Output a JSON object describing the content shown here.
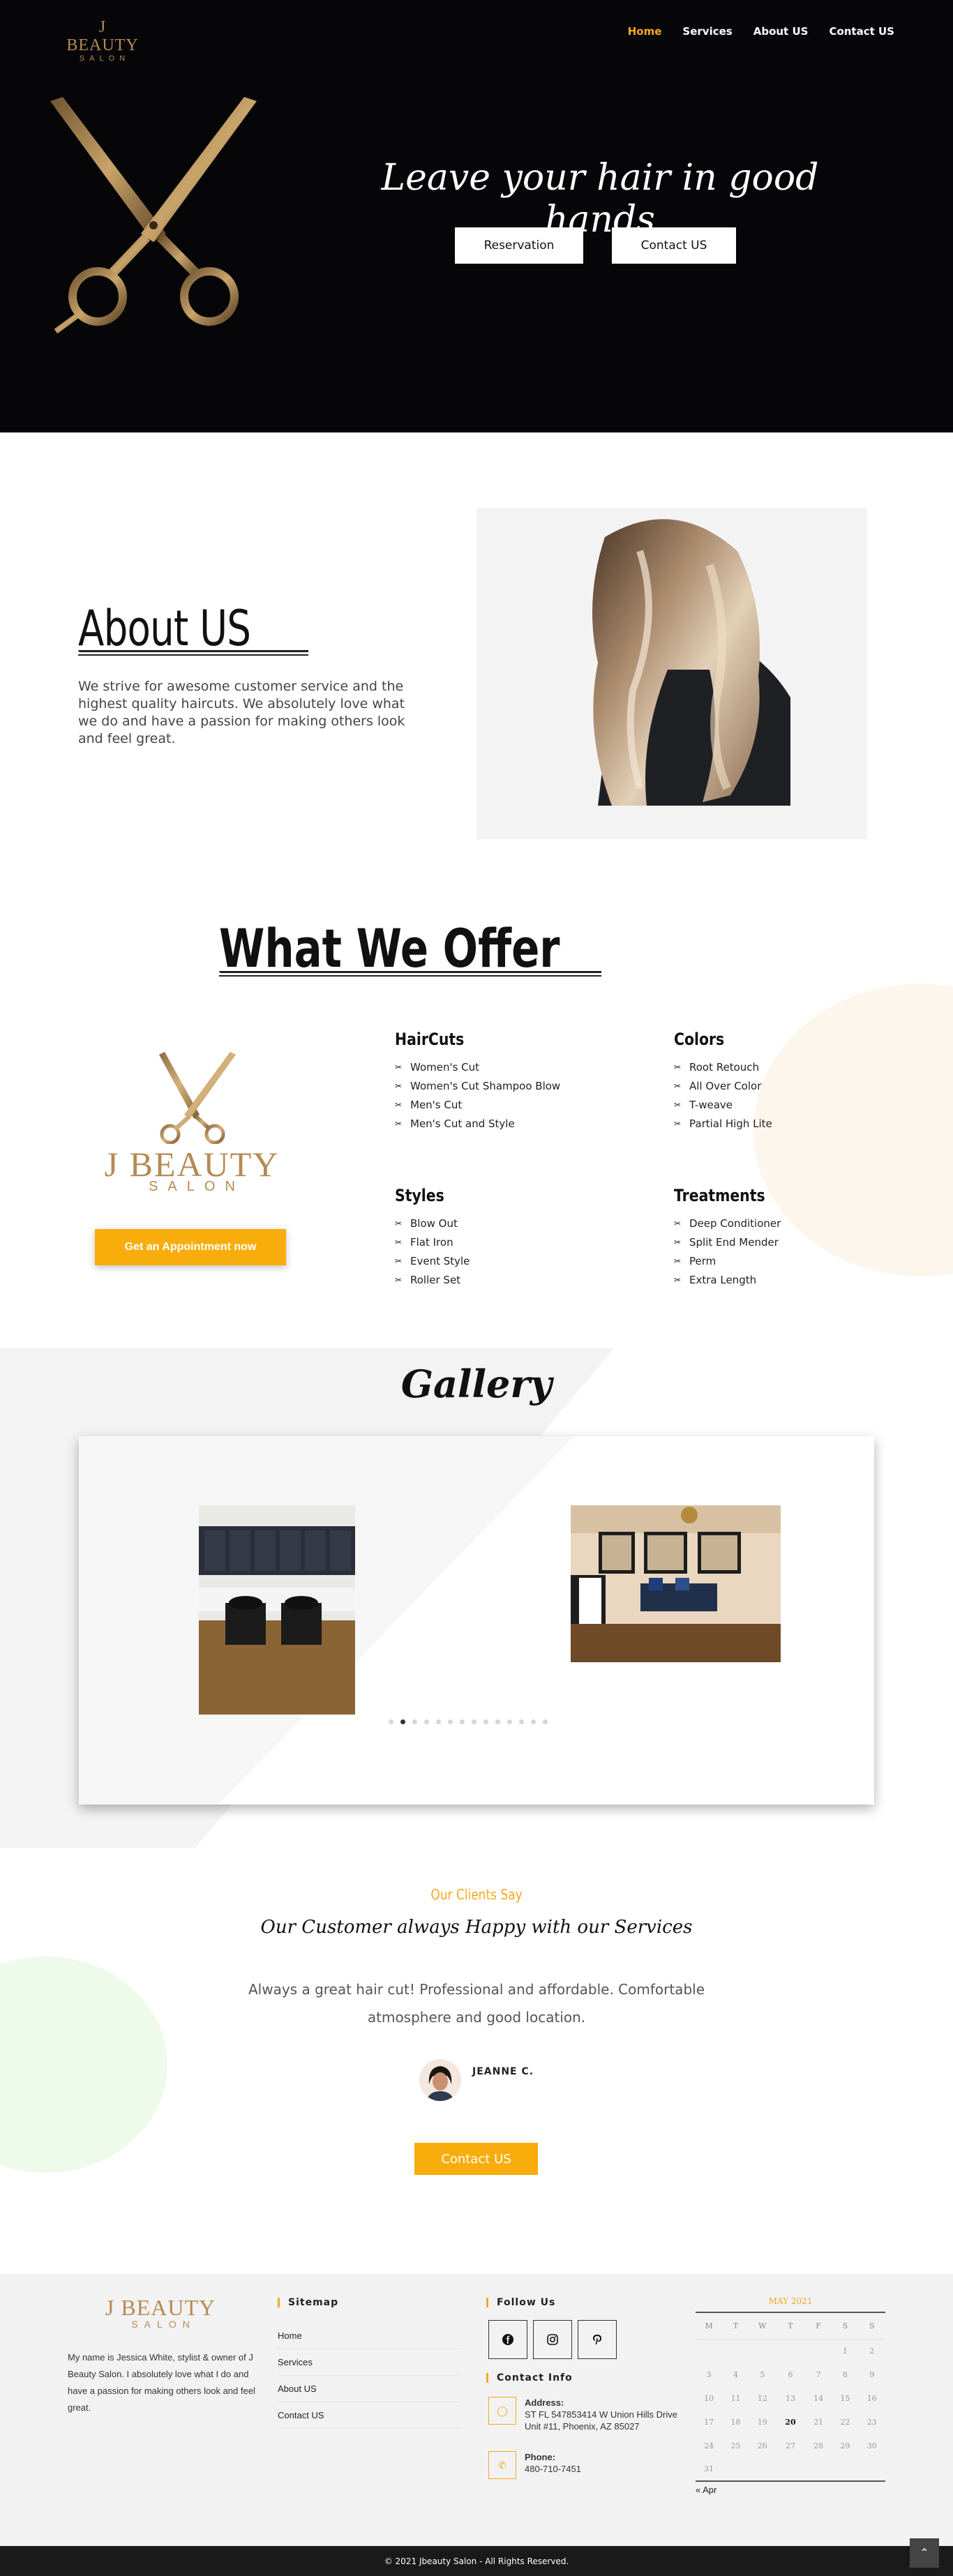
{
  "brand": {
    "line1": "J BEAUTY",
    "line2": "SALON",
    "gold": "#b58a55",
    "accent": "#f7a823"
  },
  "nav": {
    "items": [
      {
        "label": "Home",
        "active": true
      },
      {
        "label": "Services",
        "active": false
      },
      {
        "label": "About US",
        "active": false
      },
      {
        "label": "Contact US",
        "active": false
      }
    ]
  },
  "hero": {
    "title": "Leave your hair in good hands",
    "reserve_label": "Reservation",
    "contact_label": "Contact US"
  },
  "about": {
    "title": "About US",
    "text": "We strive for awesome customer service and the highest quality haircuts. We absolutely love what we do and have a passion for making others look and feel great."
  },
  "offer": {
    "title": "What We Offer",
    "appointment_label": "Get an Appointment now",
    "categories": [
      {
        "name": "HairCuts",
        "items": [
          "Women's Cut",
          "Women's Cut Shampoo Blow",
          "Men's Cut",
          "Men's Cut and Style"
        ]
      },
      {
        "name": "Colors",
        "items": [
          "Root Retouch",
          "All Over Color",
          "T-weave",
          "Partial High Lite"
        ]
      },
      {
        "name": "Styles",
        "items": [
          "Blow Out",
          "Flat Iron",
          "Event Style",
          "Roller Set"
        ]
      },
      {
        "name": "Treatments",
        "items": [
          "Deep Conditioner",
          "Split End Mender",
          "Perm",
          "Extra Length"
        ]
      }
    ]
  },
  "gallery": {
    "title": "Gallery",
    "slide_count": 14,
    "active_slide": 1
  },
  "testimonials": {
    "kicker": "Our Clients Say",
    "subtitle": "Our Customer always Happy with our Services",
    "quote": "Always a great hair cut! Professional and affordable. Comfortable atmosphere and good location.",
    "author": "JEANNE C.",
    "contact_label": "Contact US"
  },
  "footer": {
    "about": "My name is Jessica White, stylist & owner of J Beauty Salon. I absolutely love what I do and have a passion for making others look and feel great.",
    "sitemap_title": "Sitemap",
    "sitemap": [
      "Home",
      "Services",
      "About US",
      "Contact US"
    ],
    "follow_title": "Follow Us",
    "social": [
      "facebook-icon",
      "instagram-icon",
      "pinterest-icon"
    ],
    "contact_title": "Contact Info",
    "address_label": "Address:",
    "address": "ST FL 547853414 W Union Hills Drive Unit #11, Phoenix, AZ 85027",
    "phone_label": "Phone:",
    "phone": "480-710-7451",
    "calendar": {
      "caption": "MAY 2021",
      "weekdays": [
        "M",
        "T",
        "W",
        "T",
        "F",
        "S",
        "S"
      ],
      "weeks": [
        [
          "",
          "",
          "",
          "",
          "",
          "1",
          "2"
        ],
        [
          "3",
          "4",
          "5",
          "6",
          "7",
          "8",
          "9"
        ],
        [
          "10",
          "11",
          "12",
          "13",
          "14",
          "15",
          "16"
        ],
        [
          "17",
          "18",
          "19",
          "20",
          "21",
          "22",
          "23"
        ],
        [
          "24",
          "25",
          "26",
          "27",
          "28",
          "29",
          "30"
        ],
        [
          "31",
          "",
          "",
          "",
          "",
          "",
          ""
        ]
      ],
      "today": "20",
      "prev_label": "« Apr"
    },
    "copyright": "© 2021 Jbeauty Salon - All Rights Reserved."
  }
}
